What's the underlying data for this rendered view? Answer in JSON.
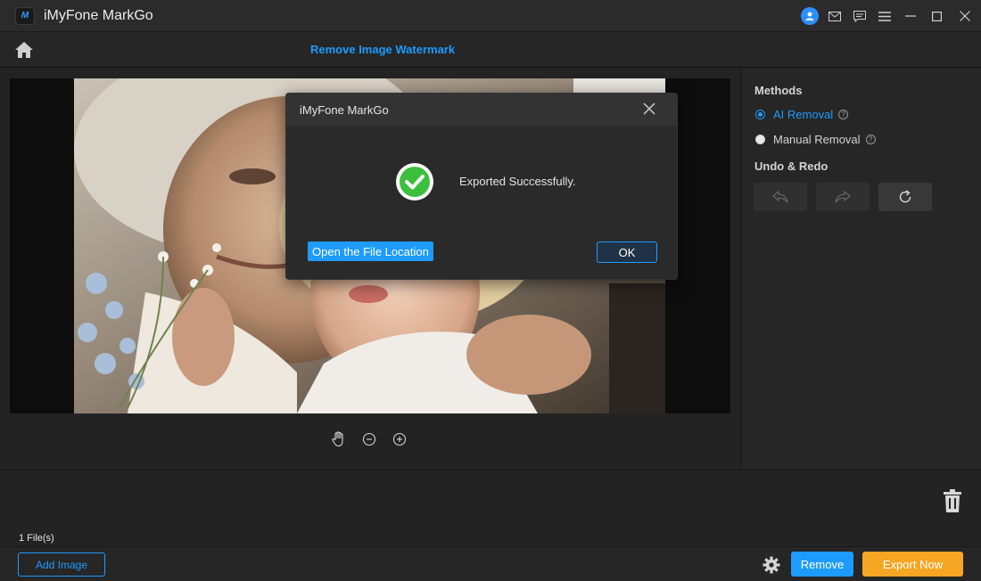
{
  "app": {
    "title": "iMyFone MarkGo",
    "logo_text": "M"
  },
  "header": {
    "page_title": "Remove Image Watermark"
  },
  "methods": {
    "heading": "Methods",
    "options": [
      {
        "label": "AI Removal",
        "selected": true
      },
      {
        "label": "Manual Removal",
        "selected": false
      }
    ]
  },
  "undo_redo": {
    "heading": "Undo & Redo"
  },
  "files": {
    "count_label": "1 File(s)"
  },
  "footer": {
    "add_image_label": "Add Image",
    "remove_label": "Remove",
    "export_label": "Export Now"
  },
  "dialog": {
    "title": "iMyFone MarkGo",
    "message": "Exported Successfully.",
    "open_location_label": "Open the File Location",
    "ok_label": "OK"
  },
  "colors": {
    "accent": "#1e9bff",
    "export": "#f6a623",
    "success": "#3cbf3c"
  },
  "icons": {
    "titlebar": [
      "user-icon",
      "mail-icon",
      "feedback-icon",
      "menu-icon",
      "minimize-icon",
      "maximize-icon",
      "close-icon"
    ],
    "zoom": [
      "hand-icon",
      "zoom-out-icon",
      "zoom-in-icon"
    ]
  }
}
